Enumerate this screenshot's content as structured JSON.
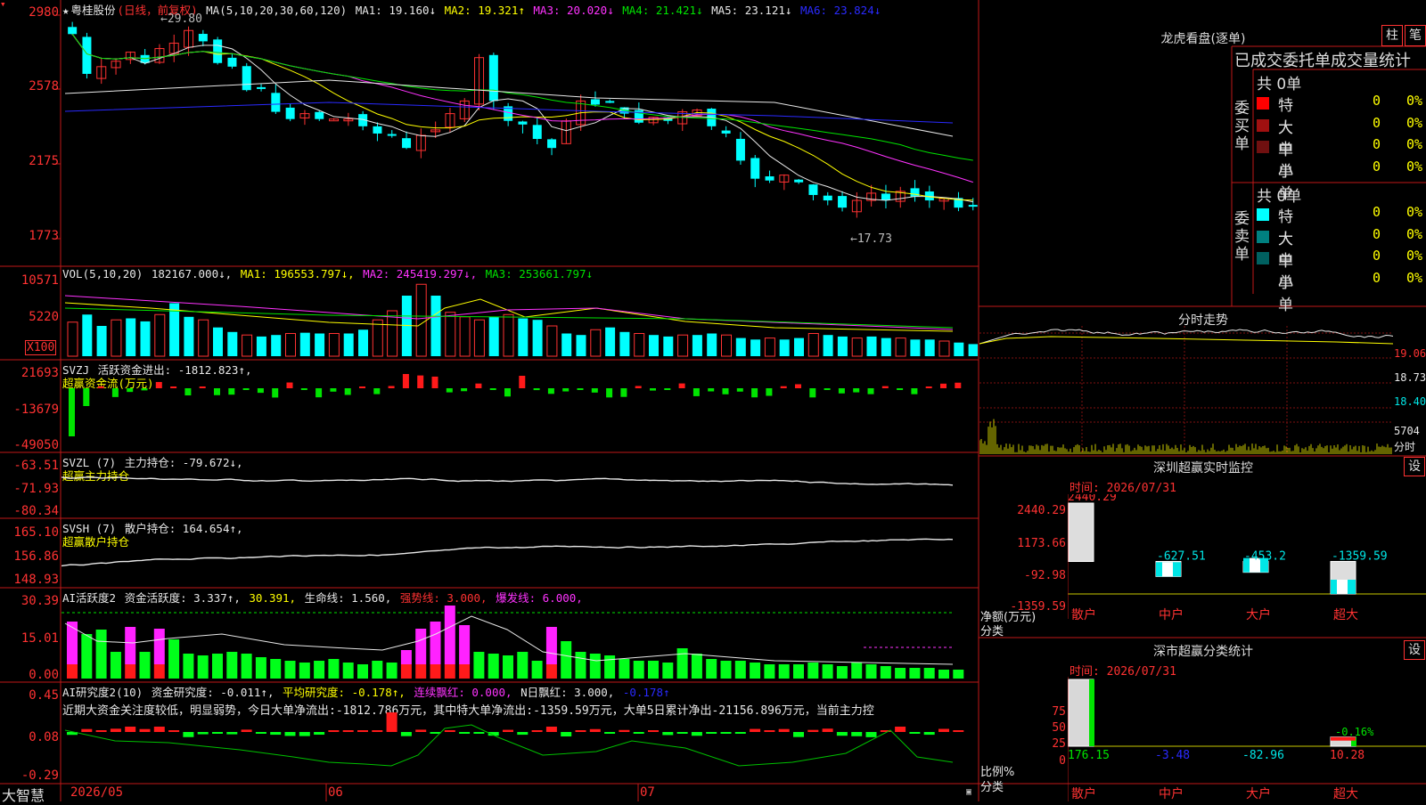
{
  "stock": {
    "name": "粤桂股份",
    "period": "(日线，前复权)",
    "max_label": "29.80",
    "min_label": "17.73"
  },
  "main_chart": {
    "header": {
      "ma_prefix": "MA(5,10,20,30,60,120)",
      "ma1": "MA1: 19.160↓",
      "ma2": "MA2: 19.321↑",
      "ma3": "MA3: 20.020↓",
      "ma4": "MA4: 21.421↓",
      "ma5": "MA5: 23.121↓",
      "ma6": "MA6: 23.824↓"
    },
    "y_ticks": [
      "2980",
      "2578",
      "2175",
      "1773"
    ]
  },
  "vol_panel": {
    "header": {
      "prefix": "VOL(5,10,20)",
      "value": "182167.000↓,",
      "ma1": "MA1: 196553.797↓,",
      "ma2": "MA2: 245419.297↓,",
      "ma3": "MA3: 253661.797↓"
    },
    "y_ticks": [
      "10571",
      "5220",
      "X100"
    ]
  },
  "svzj_panel": {
    "header": {
      "prefix": "SVZJ",
      "value": "活跃资金进出: -1812.823↑,",
      "subtitle": "超赢资金流(万元)"
    },
    "y_ticks": [
      "21693",
      "-13679",
      "-49050"
    ]
  },
  "svzl_panel": {
    "header": {
      "prefix": "SVZL (7)",
      "value": "主力持仓: -79.672↓,",
      "subtitle": "超赢主力持仓"
    },
    "y_ticks": [
      "-63.51",
      "-71.93",
      "-80.34"
    ]
  },
  "svsh_panel": {
    "header": {
      "prefix": "SVSH (7)",
      "value": "散户持仓: 164.654↑,",
      "subtitle": "超赢散户持仓"
    },
    "y_ticks": [
      "165.10",
      "156.86",
      "148.93"
    ]
  },
  "ai_active_panel": {
    "header": {
      "prefix": "AI活跃度2",
      "value": "资金活跃度: 3.337↑,",
      "v2": "30.391,",
      "life": "生命线: 1.560,",
      "strong": "强势线: 3.000,",
      "burst": "爆发线: 6.000,"
    },
    "y_ticks": [
      "30.39",
      "15.01",
      "0.00"
    ]
  },
  "ai_research_panel": {
    "header": {
      "prefix": "AI研究度2(10)",
      "value": "资金研究度: -0.011↑,",
      "avg": "平均研究度: -0.178↑,",
      "streak": "连续飘红: 0.000,",
      "nday": "N日飘红: 3.000,",
      "last": "-0.178↑"
    },
    "commentary": "近期大资金关注度较低，明显弱势，今日大单净流出:-1812.786万元，其中特大单净流出:-1359.59万元，大单5日累计净出-21156.896万元，当前主力控",
    "y_ticks": [
      "0.45",
      "0.08",
      "-0.29"
    ]
  },
  "x_axis": {
    "brand": "大智慧",
    "labels": [
      "2026/05",
      "06",
      "07"
    ]
  },
  "lhb": {
    "title": "龙虎看盘(逐单)",
    "btn_bar": "柱",
    "btn_pen": "笔",
    "subtitle": "已成交委托单成交量统计",
    "buy": {
      "side_label": "委买单",
      "total": "共 0单",
      "rows": [
        {
          "label": "特大",
          "count": "0",
          "pct": "0%"
        },
        {
          "label": "大单",
          "count": "0",
          "pct": "0%"
        },
        {
          "label": "中单",
          "count": "0",
          "pct": "0%"
        },
        {
          "label": "小单",
          "count": "0",
          "pct": "0%"
        }
      ]
    },
    "sell": {
      "side_label": "委卖单",
      "total": "共 0单",
      "rows": [
        {
          "label": "特大",
          "count": "0",
          "pct": "0%"
        },
        {
          "label": "大单",
          "count": "0",
          "pct": "0%"
        },
        {
          "label": "中单",
          "count": "0",
          "pct": "0%"
        },
        {
          "label": "小单",
          "count": "0",
          "pct": "0%"
        }
      ]
    },
    "colors": {
      "buy": [
        "#ff0000",
        "#a01010",
        "#701010",
        "#000000"
      ],
      "sell": [
        "#00ffff",
        "#008080",
        "#006060",
        "#000000"
      ]
    }
  },
  "intraday": {
    "title": "分时走势",
    "price_ticks": [
      "19.06",
      "18.73",
      "18.40"
    ],
    "vol_tick": "5704",
    "unit": "分时"
  },
  "sz_monitor": {
    "title": "深圳超赢实时监控",
    "settings": "设",
    "time": "时间: 2026/07/31",
    "y_ticks": [
      "2440.29",
      "1173.66",
      "-92.98",
      "-1359.59"
    ],
    "y_label": "净额(万元)",
    "x_label": "分类",
    "chart_data": {
      "type": "bar",
      "categories": [
        "散户",
        "中户",
        "大户",
        "超大"
      ],
      "values": [
        2440.29,
        -627.51,
        -453.2,
        -1359.59
      ],
      "value_labels": [
        "2440.29",
        "-627.51",
        "-453.2",
        "-1359.59"
      ],
      "ylim": [
        -1359.59,
        2440.29
      ]
    }
  },
  "sz_stats": {
    "title": "深市超赢分类统计",
    "settings": "设",
    "time": "时间: 2026/07/31",
    "y_ticks": [
      "75",
      "50",
      "25",
      "0"
    ],
    "y_label": "比例%",
    "x_label": "分类",
    "chart_data": {
      "type": "bar",
      "categories": [
        "散户",
        "中户",
        "大户",
        "超大"
      ],
      "values": [
        176.15,
        -3.48,
        -82.96,
        10.28
      ],
      "value_labels": [
        "176.15",
        "-3.48",
        "-82.96",
        "10.28"
      ],
      "extra_label": "-0.16%",
      "ylim": [
        0,
        75
      ]
    }
  }
}
